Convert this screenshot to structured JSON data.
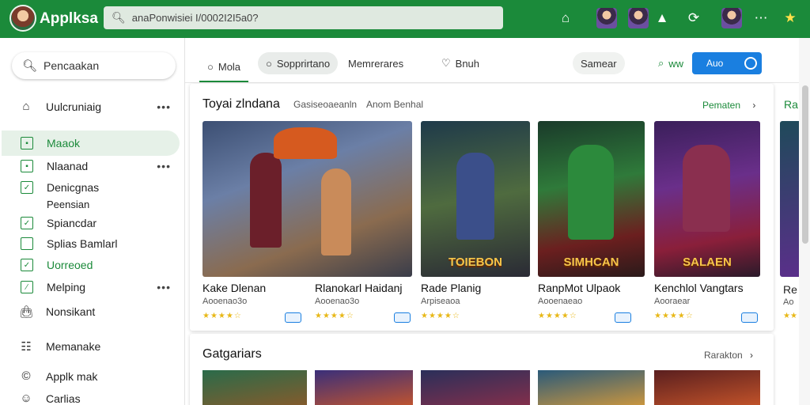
{
  "app": {
    "title": "Applksa"
  },
  "search": {
    "value": "anaPonwisiei I/0002I2I5a0?"
  },
  "sidebar": {
    "search_label": "Pencaakan",
    "items": [
      {
        "label": "Uulcruniaig"
      },
      {
        "label": "Maaok"
      },
      {
        "label": "Nlaanad"
      },
      {
        "label": "Denicgnas"
      },
      {
        "label": "Peensian"
      },
      {
        "label": "Spiancdar"
      },
      {
        "label": "Splias Bamlarl"
      },
      {
        "label": "Uorreoed"
      },
      {
        "label": "Melping"
      },
      {
        "label": "Nonsikant"
      },
      {
        "label": "Memanake"
      },
      {
        "label": "Applk mak"
      },
      {
        "label": "Carlias"
      }
    ]
  },
  "tabs": [
    {
      "label": "Mola"
    },
    {
      "label": "Sopprirtano"
    },
    {
      "label": "Memrerares"
    },
    {
      "label": "Bnuh"
    }
  ],
  "toolbar": {
    "samer": "Samear",
    "small": "ww",
    "primary": "Auo"
  },
  "section1": {
    "title": "Toyai zlndana",
    "sub1": "Gasiseoaeanln",
    "sub2": "Anom Benhal",
    "link": "Pematen",
    "peek": "Ra"
  },
  "cards": [
    {
      "name": "Kake Dlenan",
      "meta": "Aooenao3o",
      "rating": "★★★★☆",
      "label": ""
    },
    {
      "name": "Rlanokarl Haidanj",
      "meta": "Aooenao3o",
      "rating": "★★★★☆",
      "label": ""
    },
    {
      "name": "Rade Planig",
      "meta": "Arpiseaoa",
      "rating": "★★★★☆",
      "label": "TOIEBON"
    },
    {
      "name": "RanpMot Ulpaok",
      "meta": "Aooenaeao",
      "rating": "★★★★☆",
      "label": "SIMHCAN"
    },
    {
      "name": "Kenchlol Vangtars",
      "meta": "Aooraear",
      "rating": "★★★★☆",
      "label": "SALAEN"
    },
    {
      "name": "Re",
      "meta": "Ao",
      "rating": "★★",
      "label": ""
    }
  ],
  "section2": {
    "title": "Gatgariars",
    "link": "Rarakton"
  },
  "icons": {
    "search": "search-icon",
    "home": "home-icon",
    "more": "more-icon",
    "chevron": "chevron-right-icon"
  },
  "colors": {
    "brand_green": "#1b8a3a",
    "primary_blue": "#1a7fe0"
  }
}
